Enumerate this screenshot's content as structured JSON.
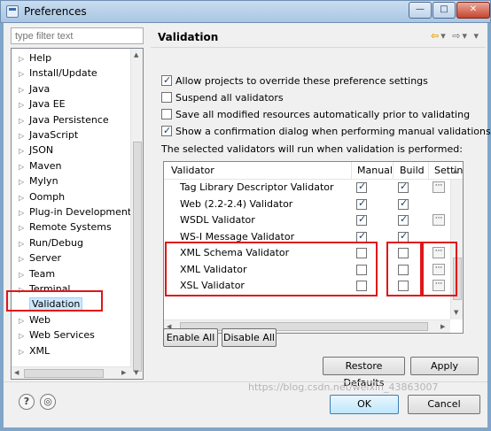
{
  "window": {
    "title": "Preferences",
    "controls": {
      "minimize": "—",
      "maximize": "□",
      "close": "✕"
    }
  },
  "left": {
    "filter_placeholder": "type filter text",
    "tree_items": [
      {
        "label": "Help"
      },
      {
        "label": "Install/Update"
      },
      {
        "label": "Java"
      },
      {
        "label": "Java EE"
      },
      {
        "label": "Java Persistence"
      },
      {
        "label": "JavaScript"
      },
      {
        "label": "JSON"
      },
      {
        "label": "Maven"
      },
      {
        "label": "Mylyn"
      },
      {
        "label": "Oomph"
      },
      {
        "label": "Plug-in Development"
      },
      {
        "label": "Remote Systems"
      },
      {
        "label": "Run/Debug"
      },
      {
        "label": "Server"
      },
      {
        "label": "Team"
      },
      {
        "label": "Terminal"
      },
      {
        "label": "Validation"
      },
      {
        "label": "Web"
      },
      {
        "label": "Web Services"
      },
      {
        "label": "XML"
      }
    ],
    "selected": "Validation"
  },
  "page": {
    "title": "Validation",
    "options": [
      {
        "label": "Allow projects to override these preference settings",
        "checked": true
      },
      {
        "label": "Suspend all validators",
        "checked": false
      },
      {
        "label": "Save all modified resources automatically prior to validating",
        "checked": false
      },
      {
        "label": "Show a confirmation dialog when performing manual validations",
        "checked": true
      }
    ],
    "info": "The selected validators will run when validation is performed:",
    "table": {
      "columns": [
        "Validator",
        "Manual",
        "Build",
        "Settin"
      ],
      "rows": [
        {
          "name": "Tag Library Descriptor Validator",
          "manual": true,
          "build": true,
          "settings": true
        },
        {
          "name": "Web (2.2-2.4) Validator",
          "manual": true,
          "build": true,
          "settings": false
        },
        {
          "name": "WSDL Validator",
          "manual": true,
          "build": true,
          "settings": true
        },
        {
          "name": "WS-I Message Validator",
          "manual": true,
          "build": true,
          "settings": false
        },
        {
          "name": "XML Schema Validator",
          "manual": false,
          "build": false,
          "settings": true
        },
        {
          "name": "XML Validator",
          "manual": false,
          "build": false,
          "settings": true
        },
        {
          "name": "XSL Validator",
          "manual": false,
          "build": false,
          "settings": true
        }
      ],
      "settings_glyph": "···"
    },
    "buttons": {
      "enable_all": "Enable All",
      "disable_all": "Disable All",
      "restore_defaults": "Restore Defaults",
      "apply": "Apply"
    }
  },
  "footer": {
    "ok": "OK",
    "cancel": "Cancel",
    "help_glyph": "?",
    "watermark": "https://blog.csdn.net/weixin_43863007"
  }
}
